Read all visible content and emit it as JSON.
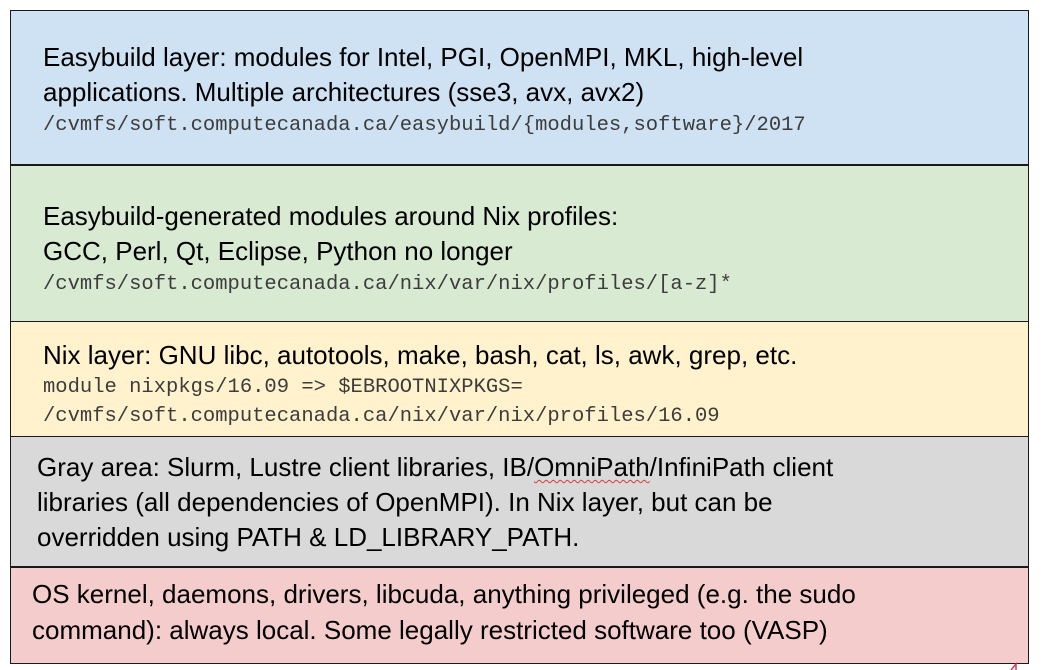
{
  "layers": {
    "easybuild": {
      "line1": "Easybuild layer: modules for Intel, PGI, OpenMPI, MKL, high-level",
      "line2": "applications. Multiple architectures (sse3, avx, avx2)",
      "path": "/cvmfs/soft.computecanada.ca/easybuild/{modules,software}/2017",
      "color": "#cfe2f3"
    },
    "nix_profiles": {
      "line1": "Easybuild-generated modules around Nix profiles:",
      "line2": "GCC, Perl, Qt, Eclipse, Python no longer",
      "path": "/cvmfs/soft.computecanada.ca/nix/var/nix/profiles/[a-z]*",
      "color": "#d9ead3"
    },
    "nix": {
      "line1": "Nix layer: GNU libc, autotools, make, bash, cat, ls, awk, grep, etc.",
      "command": "module nixpkgs/16.09 => $EBROOTNIXPKGS=",
      "path": "/cvmfs/soft.computecanada.ca/nix/var/nix/profiles/16.09",
      "color": "#fff2cc"
    },
    "gray": {
      "line1_a": "Gray area: Slurm, Lustre client libraries, IB/",
      "line1_b": "OmniPath",
      "line1_c": "/InfiniPath client",
      "line2": "libraries (all dependencies of OpenMPI). In Nix layer, but can be",
      "line3": "overridden using PATH & LD_LIBRARY_PATH.",
      "color": "#d9d9d9"
    },
    "os": {
      "line1": "OS kernel, daemons, drivers, libcuda, anything privileged (e.g. the sudo",
      "line2": "command): always local. Some legally restricted software too (VASP)",
      "color": "#f4cccc"
    }
  }
}
